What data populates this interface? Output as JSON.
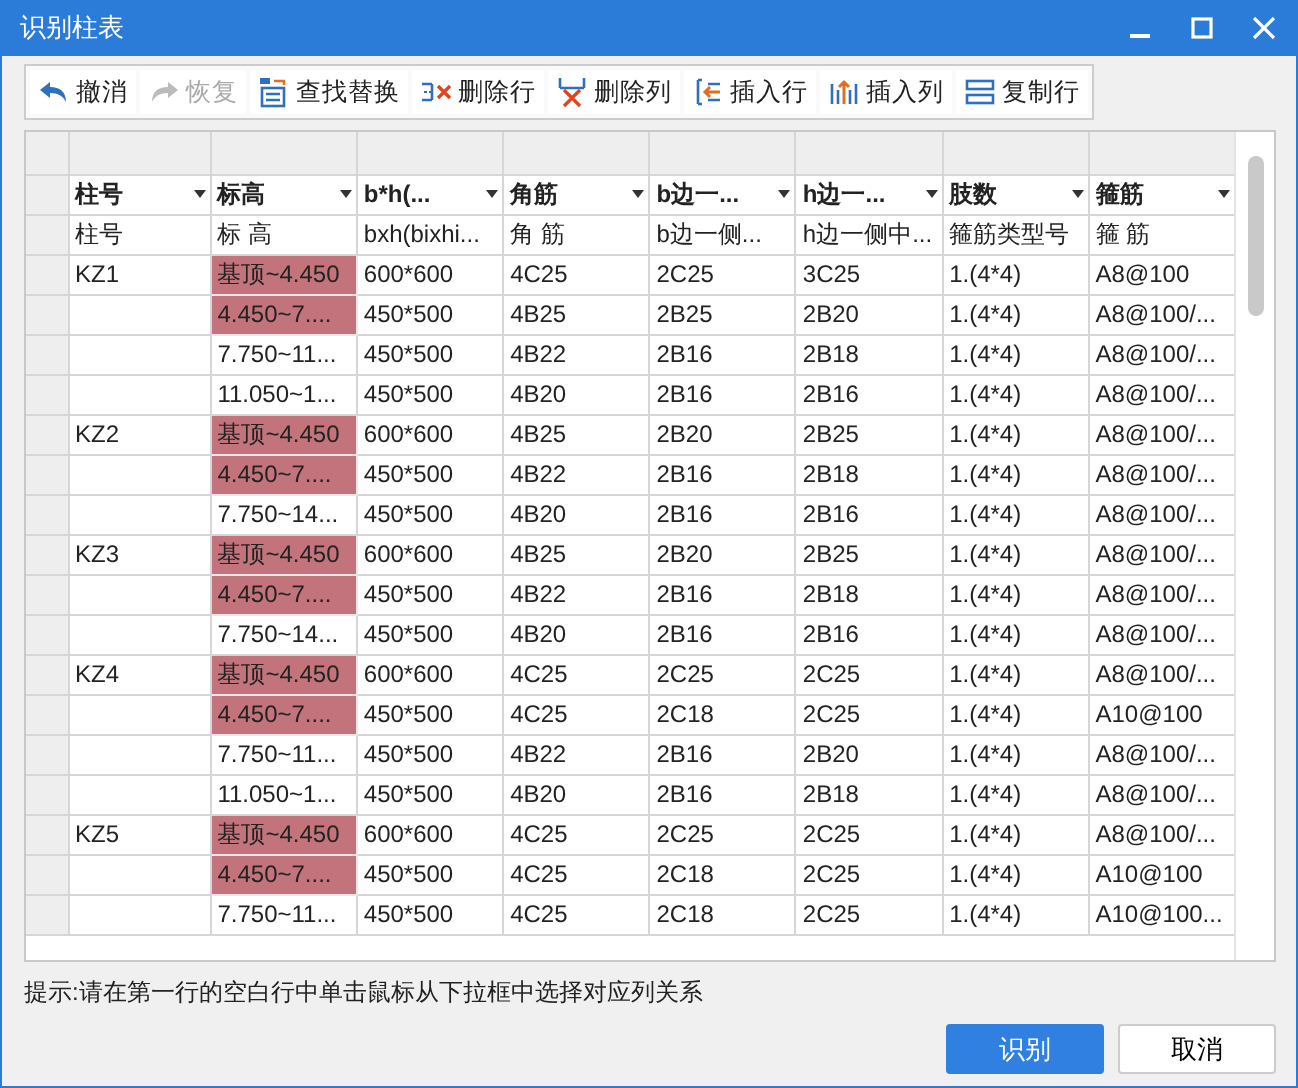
{
  "window": {
    "title": "识别柱表"
  },
  "toolbar": [
    {
      "kind": "undo",
      "label": "撤消",
      "disabled": false
    },
    {
      "kind": "redo",
      "label": "恢复",
      "disabled": true
    },
    {
      "kind": "find",
      "label": "查找替换",
      "disabled": false
    },
    {
      "kind": "delrow",
      "label": "删除行",
      "disabled": false
    },
    {
      "kind": "delcol",
      "label": "删除列",
      "disabled": false
    },
    {
      "kind": "insrow",
      "label": "插入行",
      "disabled": false
    },
    {
      "kind": "inscol",
      "label": "插入列",
      "disabled": false
    },
    {
      "kind": "copyrow",
      "label": "复制行",
      "disabled": false
    }
  ],
  "table": {
    "columns": [
      "柱号",
      "标高",
      "b*h(...",
      "角筋",
      "b边一...",
      "h边一...",
      "肢数",
      "箍筋"
    ],
    "source_headers": [
      "柱号",
      "标 高",
      "bxh(bixhi...",
      "角 筋",
      "b边一侧...",
      "h边一侧中...",
      "箍筋类型号",
      "箍 筋"
    ],
    "rows": [
      {
        "highlighted": true,
        "cells": [
          "KZ1",
          "基顶~4.450",
          "600*600",
          "4C25",
          "2C25",
          "3C25",
          "1.(4*4)",
          "A8@100"
        ]
      },
      {
        "highlighted": true,
        "cells": [
          "",
          "4.450~7....",
          "450*500",
          "4B25",
          "2B25",
          "2B20",
          "1.(4*4)",
          "A8@100/..."
        ]
      },
      {
        "highlighted": false,
        "cells": [
          "",
          "7.750~11...",
          "450*500",
          "4B22",
          "2B16",
          "2B18",
          "1.(4*4)",
          "A8@100/..."
        ]
      },
      {
        "highlighted": false,
        "cells": [
          "",
          "11.050~1...",
          "450*500",
          "4B20",
          "2B16",
          "2B16",
          "1.(4*4)",
          "A8@100/..."
        ]
      },
      {
        "highlighted": true,
        "cells": [
          "KZ2",
          "基顶~4.450",
          "600*600",
          "4B25",
          "2B20",
          "2B25",
          "1.(4*4)",
          "A8@100/..."
        ]
      },
      {
        "highlighted": true,
        "cells": [
          "",
          "4.450~7....",
          "450*500",
          "4B22",
          "2B16",
          "2B18",
          "1.(4*4)",
          "A8@100/..."
        ]
      },
      {
        "highlighted": false,
        "cells": [
          "",
          "7.750~14...",
          "450*500",
          "4B20",
          "2B16",
          "2B16",
          "1.(4*4)",
          "A8@100/..."
        ]
      },
      {
        "highlighted": true,
        "cells": [
          "KZ3",
          "基顶~4.450",
          "600*600",
          "4B25",
          "2B20",
          "2B25",
          "1.(4*4)",
          "A8@100/..."
        ]
      },
      {
        "highlighted": true,
        "cells": [
          "",
          "4.450~7....",
          "450*500",
          "4B22",
          "2B16",
          "2B18",
          "1.(4*4)",
          "A8@100/..."
        ]
      },
      {
        "highlighted": false,
        "cells": [
          "",
          "7.750~14...",
          "450*500",
          "4B20",
          "2B16",
          "2B16",
          "1.(4*4)",
          "A8@100/..."
        ]
      },
      {
        "highlighted": true,
        "cells": [
          "KZ4",
          "基顶~4.450",
          "600*600",
          "4C25",
          "2C25",
          "2C25",
          "1.(4*4)",
          "A8@100/..."
        ]
      },
      {
        "highlighted": true,
        "cells": [
          "",
          "4.450~7....",
          "450*500",
          "4C25",
          "2C18",
          "2C25",
          "1.(4*4)",
          "A10@100"
        ]
      },
      {
        "highlighted": false,
        "cells": [
          "",
          "7.750~11...",
          "450*500",
          "4B22",
          "2B16",
          "2B20",
          "1.(4*4)",
          "A8@100/..."
        ]
      },
      {
        "highlighted": false,
        "cells": [
          "",
          "11.050~1...",
          "450*500",
          "4B20",
          "2B16",
          "2B18",
          "1.(4*4)",
          "A8@100/..."
        ]
      },
      {
        "highlighted": true,
        "cells": [
          "KZ5",
          "基顶~4.450",
          "600*600",
          "4C25",
          "2C25",
          "2C25",
          "1.(4*4)",
          "A8@100/..."
        ]
      },
      {
        "highlighted": true,
        "cells": [
          "",
          "4.450~7....",
          "450*500",
          "4C25",
          "2C18",
          "2C25",
          "1.(4*4)",
          "A10@100"
        ]
      },
      {
        "highlighted": false,
        "cells": [
          "",
          "7.750~11...",
          "450*500",
          "4C25",
          "2C18",
          "2C25",
          "1.(4*4)",
          "A10@100..."
        ]
      }
    ]
  },
  "hint": "提示:请在第一行的空白行中单击鼠标从下拉框中选择对应列关系",
  "buttons": [
    {
      "label": "识别",
      "kind": "primary"
    },
    {
      "label": "取消",
      "kind": "secondary"
    }
  ]
}
